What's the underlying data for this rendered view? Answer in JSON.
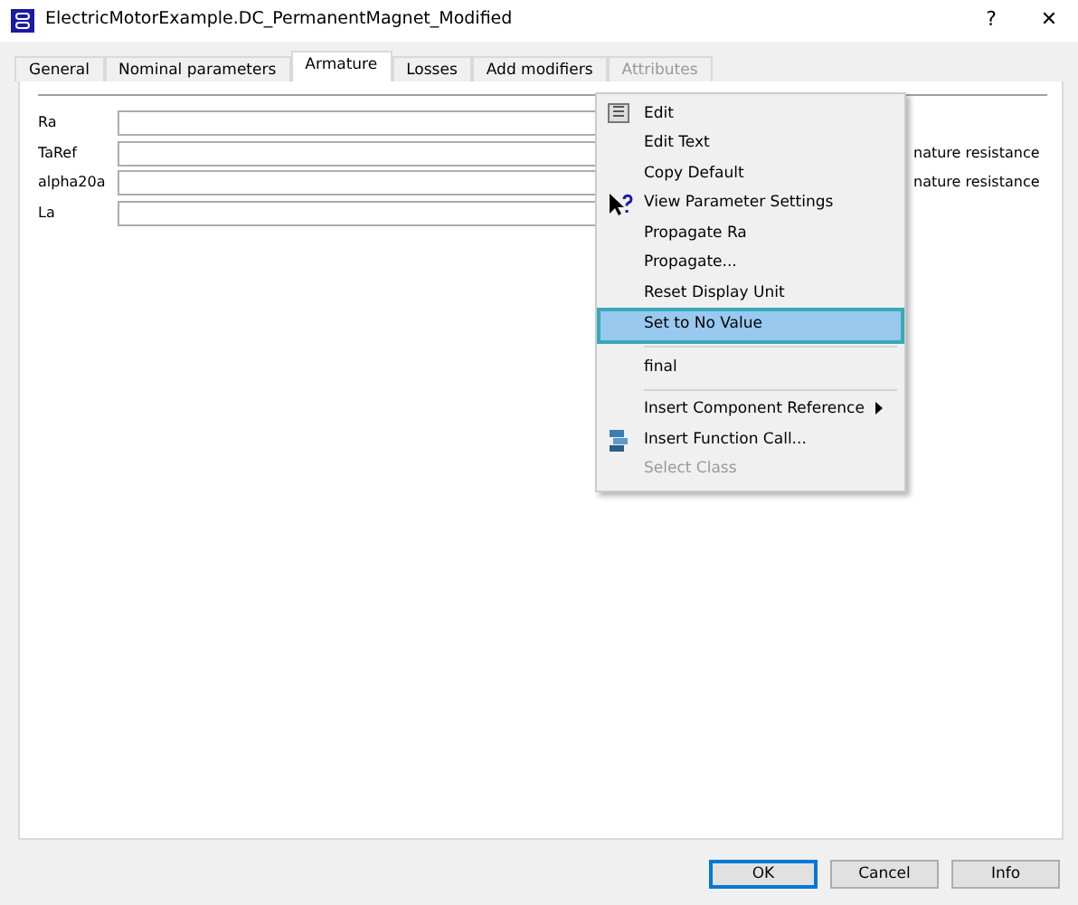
{
  "window": {
    "title": "ElectricMotorExample.DC_PermanentMagnet_Modified",
    "help": "?",
    "close": "✕"
  },
  "tabs": [
    {
      "label": "General",
      "selected": false,
      "disabled": false
    },
    {
      "label": "Nominal parameters",
      "selected": false,
      "disabled": false
    },
    {
      "label": "Armature",
      "selected": true,
      "disabled": false
    },
    {
      "label": "Losses",
      "selected": false,
      "disabled": false
    },
    {
      "label": "Add modifiers",
      "selected": false,
      "disabled": false
    },
    {
      "label": "Attributes",
      "selected": false,
      "disabled": true
    }
  ],
  "parameters": [
    {
      "name": "Ra"
    },
    {
      "name": "TaRef",
      "description": "nature resistance"
    },
    {
      "name": "alpha20a",
      "description": "nature resistance"
    },
    {
      "name": "La"
    }
  ],
  "context_menu": [
    {
      "kind": "item",
      "label": "Edit",
      "selected": false,
      "disabled": false
    },
    {
      "kind": "item",
      "label": "Edit Text",
      "selected": false,
      "disabled": false
    },
    {
      "kind": "item",
      "label": "Copy Default",
      "selected": false,
      "disabled": false
    },
    {
      "kind": "item",
      "label": "View Parameter Settings",
      "selected": false,
      "disabled": false
    },
    {
      "kind": "item",
      "label": "Propagate Ra",
      "selected": false,
      "disabled": false
    },
    {
      "kind": "item",
      "label": "Propagate...",
      "selected": false,
      "disabled": false
    },
    {
      "kind": "item",
      "label": "Reset Display Unit",
      "selected": false,
      "disabled": false
    },
    {
      "kind": "item",
      "label": "Set to No Value",
      "selected": true,
      "disabled": false
    },
    {
      "kind": "separator"
    },
    {
      "kind": "item",
      "label": "final",
      "selected": false,
      "disabled": false
    },
    {
      "kind": "separator"
    },
    {
      "kind": "item",
      "label": "Insert Component Reference",
      "submenu": true,
      "selected": false,
      "disabled": false
    },
    {
      "kind": "item",
      "label": "Insert Function Call...",
      "selected": false,
      "disabled": false
    },
    {
      "kind": "item",
      "label": "Select Class",
      "selected": false,
      "disabled": true
    }
  ],
  "buttons": [
    {
      "label": "OK",
      "default": true
    },
    {
      "label": "Cancel",
      "default": false
    },
    {
      "label": "Info",
      "default": false
    }
  ]
}
